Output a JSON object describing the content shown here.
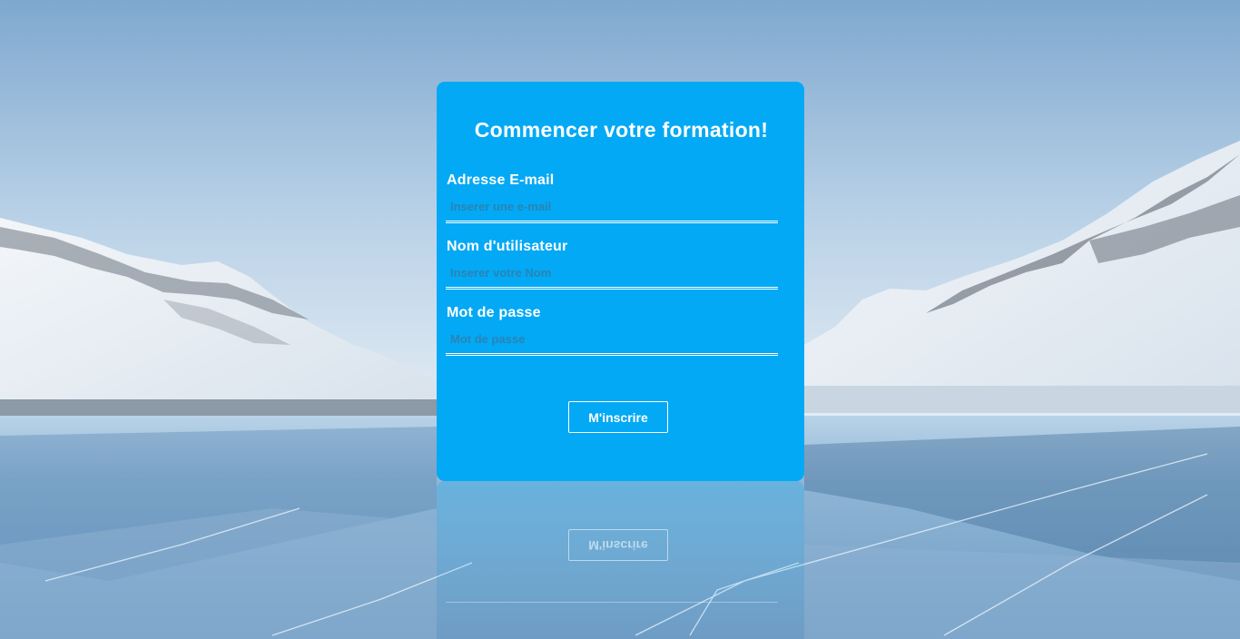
{
  "form": {
    "title": "Commencer votre formation!",
    "email": {
      "label": "Adresse E-mail",
      "placeholder": "Inserer une e-mail",
      "value": ""
    },
    "username": {
      "label": "Nom d'utilisateur",
      "placeholder": "Inserer votre Nom",
      "value": ""
    },
    "password": {
      "label": "Mot de passe",
      "placeholder": "Mot de passe",
      "value": ""
    },
    "submit_label": "M'inscrire"
  },
  "colors": {
    "card": "#03a9f4",
    "text": "#ffffff",
    "placeholder": "#2b83b3"
  }
}
